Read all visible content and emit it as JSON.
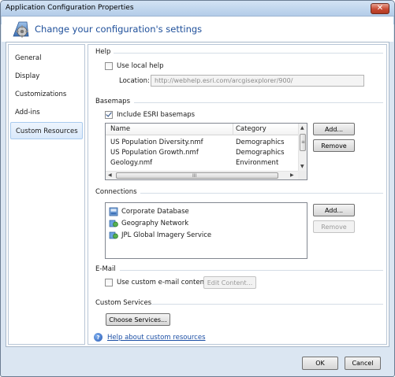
{
  "window": {
    "title": "Application Configuration Properties",
    "close_symbol": "✕",
    "header": "Change your configuration's settings",
    "header_icon": "settings-gear-icon"
  },
  "nav": {
    "items": [
      "General",
      "Display",
      "Customizations",
      "Add-ins",
      "Custom Resources"
    ],
    "selected": "Custom Resources"
  },
  "help": {
    "section_label": "Help",
    "use_local_label": "Use local help",
    "use_local_checked": false,
    "location_label": "Location:",
    "location_value": "http://webhelp.esri.com/arcgisexplorer/900/"
  },
  "basemaps": {
    "section_label": "Basemaps",
    "include_label": "Include ESRI basemaps",
    "include_checked": true,
    "columns": [
      "Name",
      "Category"
    ],
    "rows": [
      [
        "US Population Diversity.nmf",
        "Demographics"
      ],
      [
        "US Population Growth.nmf",
        "Demographics"
      ],
      [
        "Geology.nmf",
        "Environment"
      ]
    ],
    "scroll_grip": "≡",
    "hscroll_grip": "III",
    "add_label": "Add...",
    "remove_label": "Remove"
  },
  "connections": {
    "section_label": "Connections",
    "items": [
      {
        "label": "Corporate Database",
        "icon": "database-icon"
      },
      {
        "label": "Geography Network",
        "icon": "network-icon"
      },
      {
        "label": "JPL Global Imagery Service",
        "icon": "network-icon"
      }
    ],
    "add_label": "Add...",
    "remove_label": "Remove"
  },
  "email": {
    "section_label": "E-Mail",
    "use_custom_label": "Use custom e-mail content",
    "use_custom_checked": false,
    "edit_label": "Edit Content..."
  },
  "custom_services": {
    "section_label": "Custom Services",
    "choose_label": "Choose Services..."
  },
  "help_link": {
    "icon": "?",
    "text": "Help about custom resources"
  },
  "footer": {
    "ok_label": "OK",
    "cancel_label": "Cancel"
  }
}
